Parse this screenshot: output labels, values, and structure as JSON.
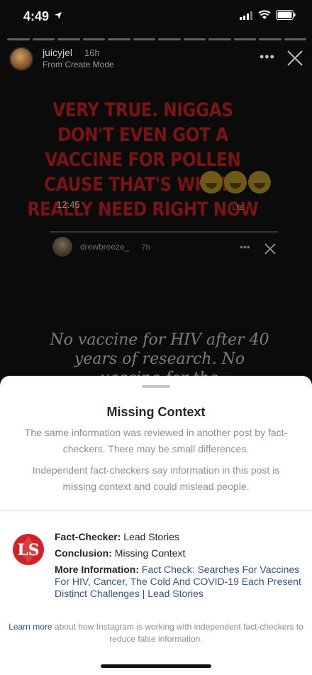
{
  "status_bar": {
    "time": "4:49"
  },
  "story": {
    "username": "juicyjel",
    "time_ago": "16h",
    "mode": "From Create Mode",
    "more_label": "•••",
    "text": "VERY TRUE. NIGGAS DON'T EVEN GOT A VACCINE FOR POLLEN CAUSE THAT'S WHAT I REALLY NEED RIGHT NOW",
    "emoji_count": 3,
    "segments": 12
  },
  "inner_screenshot": {
    "time": "12:45",
    "network": "LTE",
    "username": "drewbreeze_",
    "time_ago": "7h",
    "more_label": "•••",
    "quote": "No vaccine for HIV after 40 years of research. No vaccine for the"
  },
  "sheet": {
    "title": "Missing Context",
    "p1": "The same information was reviewed in another post by fact-checkers. There may be small differences.",
    "p2": "Independent fact-checkers say information in this post is missing context and could mislead people.",
    "fact_checker_label": "Fact-Checker:",
    "fact_checker_value": "Lead Stories",
    "conclusion_label": "Conclusion:",
    "conclusion_value": "Missing Context",
    "more_info_label": "More Information:",
    "more_info_link": "Fact Check: Searches For Vaccines For HIV, Cancer, The Cold And COVID-19 Each Present Distinct Challenges | Lead Stories",
    "learn_more_link": "Learn more",
    "learn_more_text": "about how Instagram is working with independent fact-checkers to reduce false information.",
    "logo_text": "LS",
    "colors": {
      "link": "#385185",
      "logo_red": "#d31f26"
    }
  }
}
